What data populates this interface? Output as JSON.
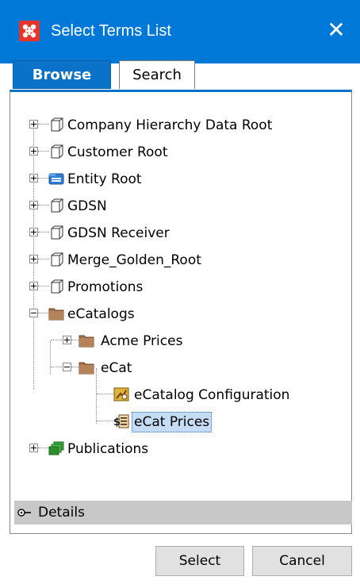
{
  "window": {
    "title": "Select Terms List",
    "close_glyph": "✕"
  },
  "tabs": [
    {
      "label": "Browse",
      "active": true
    },
    {
      "label": "Search",
      "active": false
    }
  ],
  "tree": [
    {
      "label": "Company Hierarchy Data Root",
      "icon": "node-cube-icon",
      "expanded": false
    },
    {
      "label": "Customer Root",
      "icon": "node-cube-icon",
      "expanded": false
    },
    {
      "label": "Entity Root",
      "icon": "entity-root-icon",
      "expanded": false
    },
    {
      "label": "GDSN",
      "icon": "node-cube-icon",
      "expanded": false
    },
    {
      "label": "GDSN Receiver",
      "icon": "node-cube-icon",
      "expanded": false
    },
    {
      "label": "Merge_Golden_Root",
      "icon": "node-cube-icon",
      "expanded": false
    },
    {
      "label": "Promotions",
      "icon": "node-cube-icon",
      "expanded": false
    },
    {
      "label": "eCatalogs",
      "icon": "folder-icon",
      "expanded": true
    },
    {
      "label": "Acme Prices",
      "icon": "folder-icon",
      "expanded": false
    },
    {
      "label": "eCat",
      "icon": "folder-icon",
      "expanded": true
    },
    {
      "label": "eCatalog Configuration",
      "icon": "ecatalog-configuration-icon"
    },
    {
      "label": "eCat Prices",
      "icon": "price-list-icon",
      "selected": true
    },
    {
      "label": "Publications",
      "icon": "publications-icon",
      "expanded": false
    }
  ],
  "details": {
    "label": "Details",
    "icon": "collapse-toggle-icon"
  },
  "buttons": {
    "select": "Select",
    "cancel": "Cancel"
  },
  "colors": {
    "titlebar": "#0078d7",
    "active_tab": "#0a73c9",
    "selection": "#c5dcf5"
  }
}
